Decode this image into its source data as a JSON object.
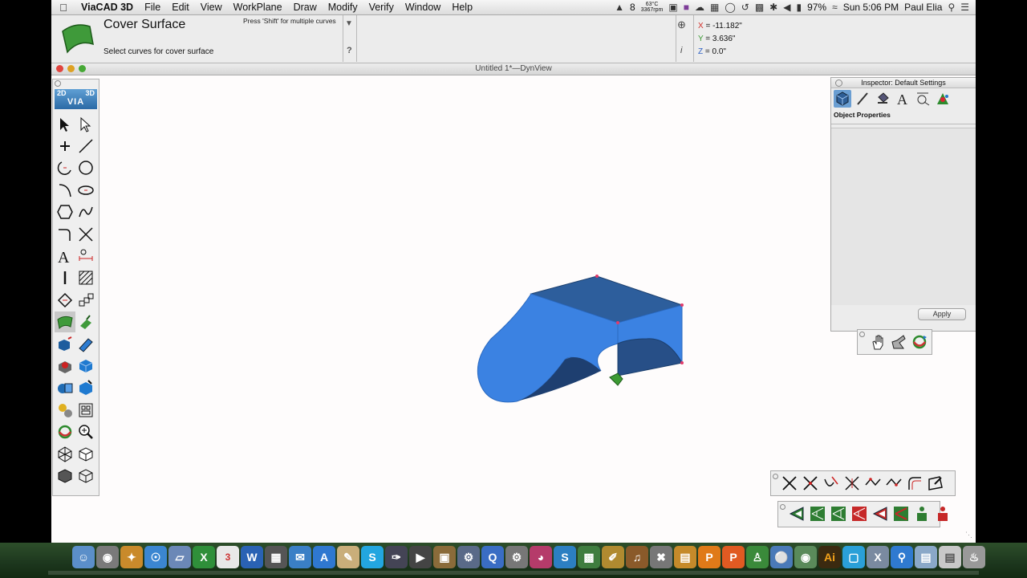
{
  "menubar": {
    "app_name": "ViaCAD 3D",
    "items": [
      "File",
      "Edit",
      "View",
      "WorkPlane",
      "Draw",
      "Modify",
      "Verify",
      "Window",
      "Help"
    ],
    "status": {
      "adobe_count": "8",
      "temperature": "63°C",
      "fan_speed": "3367rpm",
      "battery": "97%",
      "clock": "Sun 5:06 PM",
      "user": "Paul Elia"
    }
  },
  "tool_header": {
    "tool_name": "Cover Surface",
    "hint": "Press 'Shift' for multiple curves",
    "prompt": "Select curves for cover surface",
    "help_label": "?",
    "info_label": "i",
    "coords": {
      "x_label": "X",
      "x_value": "-11.182\"",
      "y_label": "Y",
      "y_value": "3.636\"",
      "z_label": "Z",
      "z_value": "0.0\""
    }
  },
  "document": {
    "title": "Untitled 1*—DynView"
  },
  "toolbox": {
    "badge_2d": "2D",
    "badge_3d": "3D",
    "badge_via": "VIA",
    "tools": [
      [
        "select-arrow",
        "select-hollow-arrow"
      ],
      [
        "point",
        "line"
      ],
      [
        "arc",
        "circle"
      ],
      [
        "curve",
        "ellipse"
      ],
      [
        "polygon",
        "spline"
      ],
      [
        "fillet-corner",
        "trim-cross"
      ],
      [
        "text",
        "dimension"
      ],
      [
        "vertical-line",
        "hatch"
      ],
      [
        "transform",
        "array"
      ],
      [
        "cover-surface",
        "extrude-surface"
      ],
      [
        "solid-extrude",
        "solid-sweep"
      ],
      [
        "boolean-subtract",
        "cube-solid"
      ],
      [
        "shell-solid",
        "solid-edit"
      ],
      [
        "light-render",
        "layers"
      ],
      [
        "rotate-view",
        "zoom"
      ],
      [
        "isometric-view",
        "box-view"
      ],
      [
        "shaded-view",
        "wireframe-view"
      ]
    ]
  },
  "inspector": {
    "title": "Inspector: Default Settings",
    "section_label": "Object Properties",
    "apply_label": "Apply",
    "tabs": [
      "cube-tab",
      "pen-tab",
      "paint-tab",
      "text-tab",
      "dimension-tab",
      "color-tab"
    ]
  },
  "colors": {
    "surface_front": "#3b82e2",
    "surface_top": "#2d5e9c",
    "surface_inner": "#1e3f70",
    "toolbox_badge": "#3a78b8",
    "edit_red": "#c62828",
    "edit_green": "#2e7d32"
  },
  "dock": {
    "ai_label": "Ai",
    "calendar_day": "3",
    "s_label": "S",
    "w_label": "W"
  }
}
